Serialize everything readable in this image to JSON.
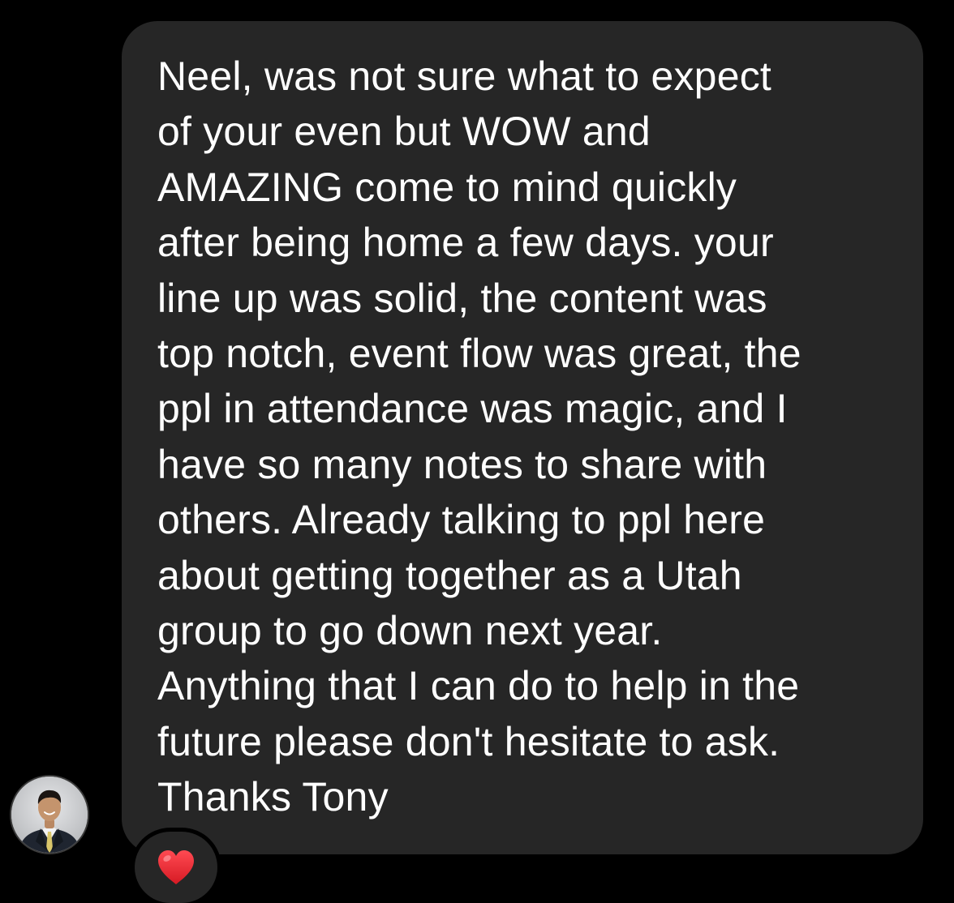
{
  "message": {
    "sender_avatar": "person-avatar",
    "lines": [
      "Neel, was not sure what to expect",
      "of your even but WOW and",
      "AMAZING come to mind quickly",
      "after being home a few days. your",
      "line up was solid, the content was",
      "top notch, event flow was great, the",
      "ppl in attendance was magic, and I",
      "have so many notes to share with",
      "others. Already talking to ppl here",
      "about getting together as a Utah",
      "group to go down next year.",
      "Anything that I can do to help in the",
      "future please don't hesitate to ask.",
      "Thanks Tony"
    ],
    "reaction": {
      "icon": "heart-icon",
      "color": "#e3262f"
    }
  },
  "colors": {
    "background": "#000000",
    "bubble": "#262626",
    "text": "#ffffff"
  }
}
